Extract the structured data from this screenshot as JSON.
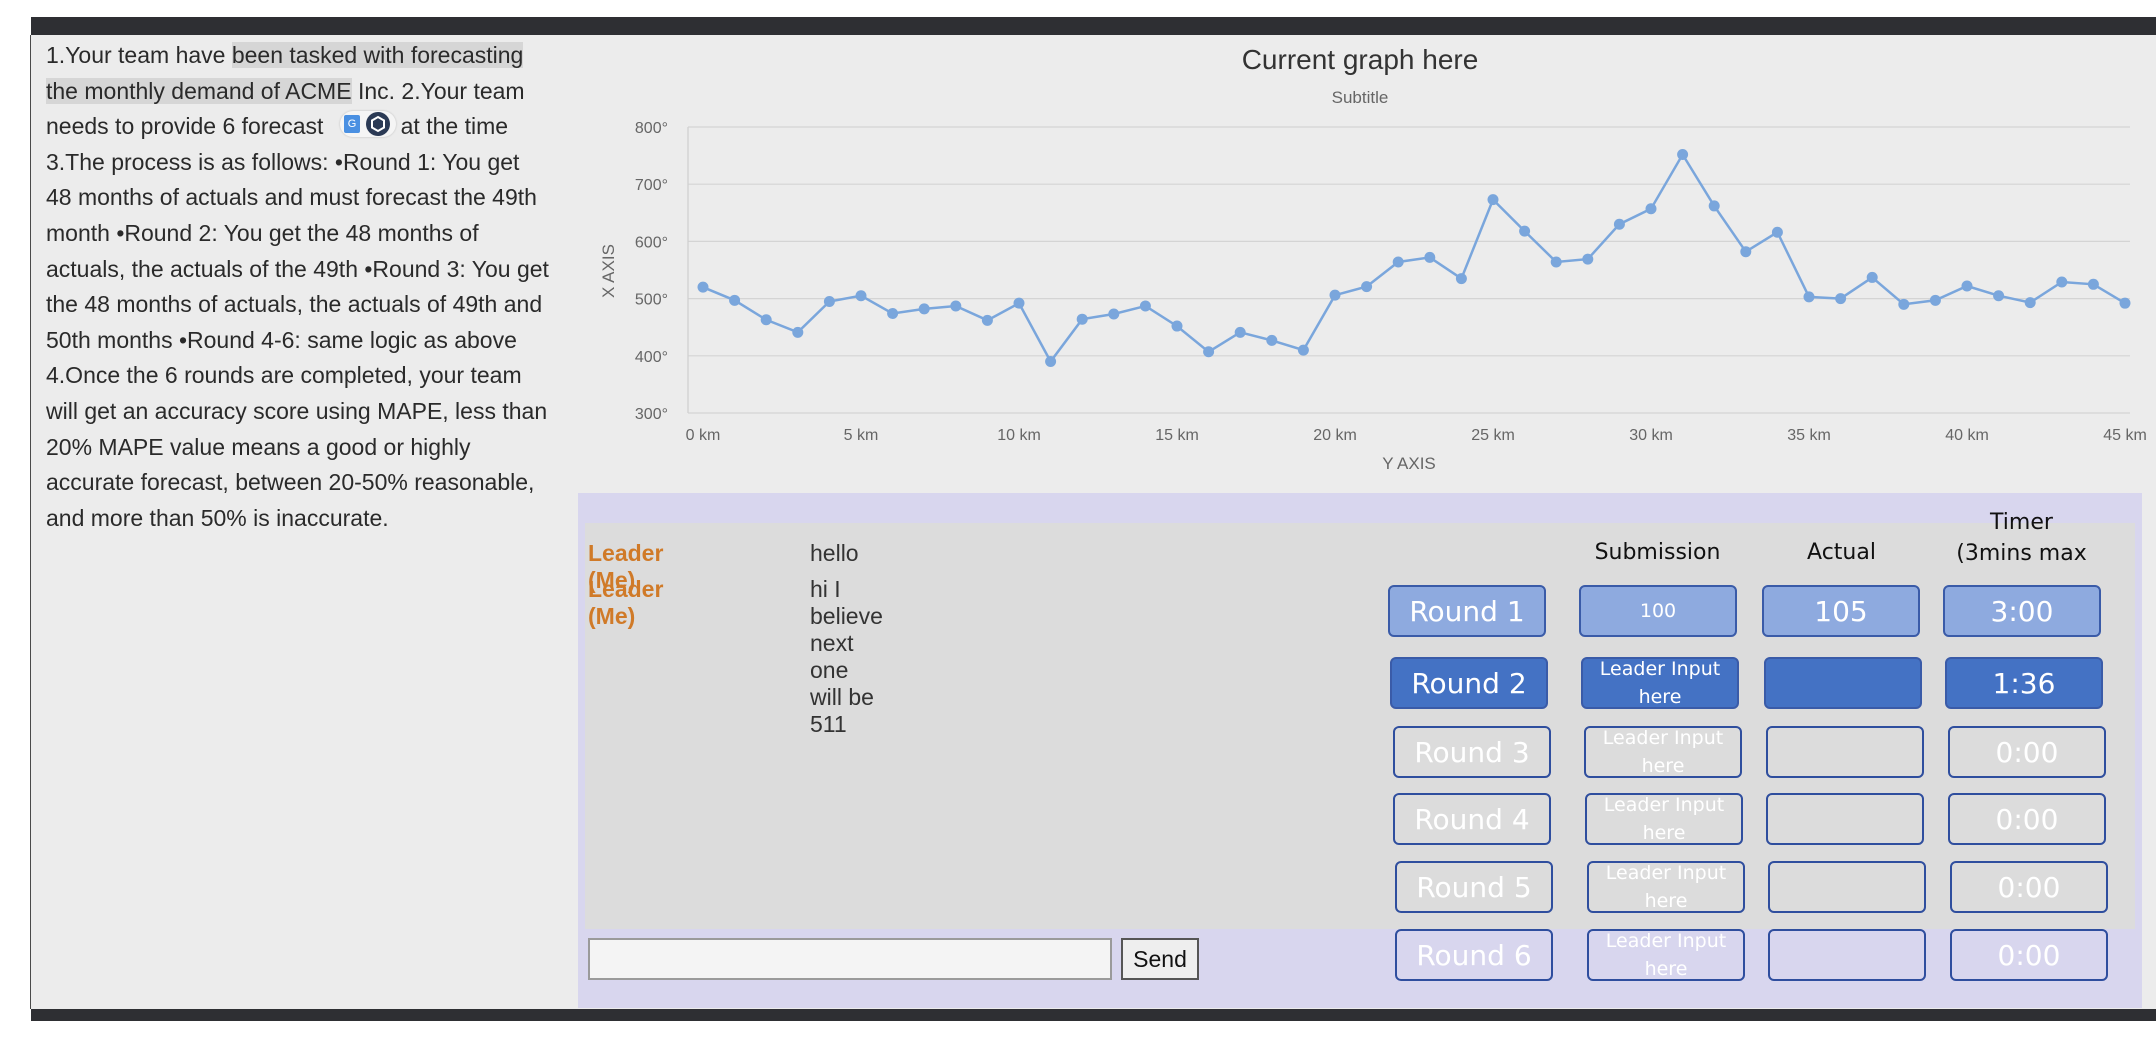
{
  "instructions": {
    "part1": "1.Your team have ",
    "part2": "been tasked with forecasting the monthly demand of ACME",
    "part3": " Inc. 2.Your team needs to provide 6 forecast",
    "part4": "e at the time 3.The process is as follows: •Round 1: You get 48 months of actuals and must forecast the 49th month •Round 2: You get the 48 months of actuals, the actuals of the 49th •Round 3: You get the 48 months of actuals, the actuals of 49th and 50th months •Round 4-6: same logic as above 4.Once the 6 rounds are completed, your team will get an accuracy score using MAPE, less than 20% MAPE value means a good or highly accurate forecast, between 20-50% reasonable, and more than 50% is inaccurate."
  },
  "chart_data": {
    "type": "line",
    "title": "Current graph here",
    "subtitle": "Subtitle",
    "xlabel": "Y AXIS",
    "ylabel": "X AXIS",
    "xlim": [
      0,
      45
    ],
    "ylim": [
      300,
      800
    ],
    "x_ticks": [
      "0 km",
      "5 km",
      "10 km",
      "15 km",
      "20 km",
      "25 km",
      "30 km",
      "35 km",
      "40 km",
      "45 km"
    ],
    "y_ticks": [
      "300°",
      "400°",
      "500°",
      "600°",
      "700°",
      "800°"
    ],
    "grid": true,
    "color": "#7aa6dc",
    "x": [
      0,
      1,
      2,
      3,
      4,
      5,
      6,
      7,
      8,
      9,
      10,
      11,
      12,
      13,
      14,
      15,
      16,
      17,
      18,
      19,
      20,
      21,
      22,
      23,
      24,
      25,
      26,
      27,
      28,
      29,
      30,
      31,
      32,
      33,
      34,
      35,
      36,
      37,
      38,
      39,
      40,
      41,
      42,
      43,
      44,
      45
    ],
    "y": [
      520,
      497,
      463,
      441,
      495,
      505,
      474,
      482,
      487,
      462,
      492,
      390,
      464,
      473,
      487,
      452,
      407,
      441,
      427,
      410,
      506,
      521,
      564,
      572,
      535,
      673,
      618,
      564,
      569,
      630,
      657,
      752,
      662,
      582,
      616,
      503,
      500,
      537,
      490,
      497,
      522,
      505,
      493,
      529,
      525,
      492
    ]
  },
  "chat": {
    "messages": [
      {
        "sender": "Leader (Me)",
        "text": "hello"
      },
      {
        "sender": "Leader (Me)",
        "text": "hi I believe next one will be 511"
      }
    ],
    "input_value": "",
    "send_label": "Send"
  },
  "table": {
    "headers": {
      "submission": "Submission",
      "actual": "Actual",
      "timer_line1": "Timer",
      "timer_line2": "(3mins max"
    },
    "rounds": [
      {
        "label": "Round 1",
        "submission": "100",
        "actual": "105",
        "timer": "3:00",
        "status": "completed"
      },
      {
        "label": "Round 2",
        "submission": "Leader Input here",
        "actual": "",
        "timer": "1:36",
        "status": "active"
      },
      {
        "label": "Round 3",
        "submission": "Leader Input here",
        "actual": "",
        "timer": "0:00",
        "status": "pending"
      },
      {
        "label": "Round 4",
        "submission": "Leader Input here",
        "actual": "",
        "timer": "0:00",
        "status": "pending"
      },
      {
        "label": "Round 5",
        "submission": "Leader Input here",
        "actual": "",
        "timer": "0:00",
        "status": "pending"
      },
      {
        "label": "Round 6",
        "submission": "Leader Input here",
        "actual": "",
        "timer": "0:00",
        "status": "pending"
      }
    ]
  }
}
